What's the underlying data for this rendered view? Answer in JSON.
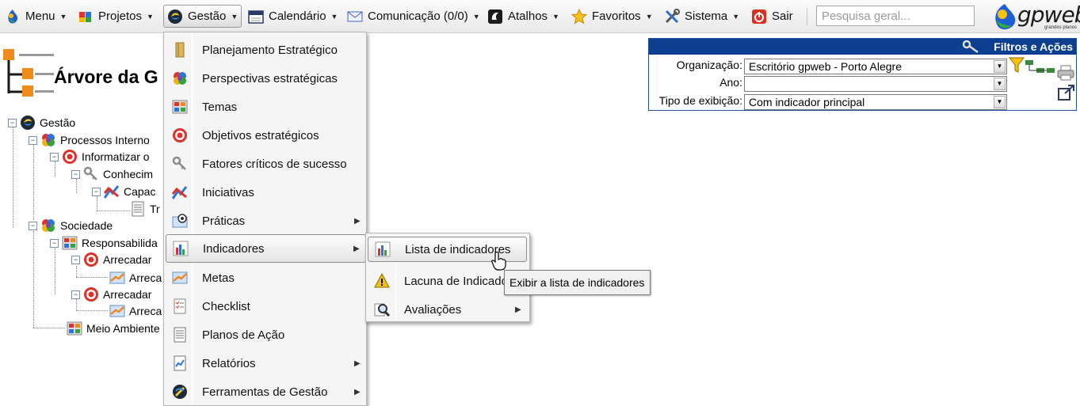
{
  "topbar": {
    "items": [
      {
        "label": "Menu",
        "icon": "gpweb-logo-icon",
        "has_caret": true
      },
      {
        "label": "Projetos",
        "icon": "puzzle-icon",
        "has_caret": true
      },
      {
        "label": "Gestão",
        "icon": "gestao-icon",
        "has_caret": true,
        "active": true
      },
      {
        "label": "Calendário",
        "icon": "calendar-icon",
        "has_caret": true
      },
      {
        "label": "Comunicação (0/0)",
        "icon": "envelope-icon",
        "has_caret": true
      },
      {
        "label": "Atalhos",
        "icon": "shortcut-icon",
        "has_caret": true
      },
      {
        "label": "Favoritos",
        "icon": "star-icon",
        "has_caret": true
      },
      {
        "label": "Sistema",
        "icon": "tools-icon",
        "has_caret": true
      },
      {
        "label": "Sair",
        "icon": "power-icon",
        "has_caret": false
      }
    ],
    "search_placeholder": "Pesquisa geral...",
    "logo_text": "gpweb",
    "logo_sub": "grandes planos"
  },
  "page": {
    "title": "Árvore da G"
  },
  "tree": [
    {
      "label": "Gestão",
      "icon": "gestao-icon"
    },
    {
      "label": "Processos Interno",
      "icon": "perspective-icon"
    },
    {
      "label": "Informatizar o",
      "icon": "target-icon"
    },
    {
      "label": "Conhecim",
      "icon": "key-icon"
    },
    {
      "label": "Capac",
      "icon": "initiative-icon"
    },
    {
      "label": "Tr",
      "icon": "document-icon"
    },
    {
      "label": "Sociedade",
      "icon": "perspective-icon"
    },
    {
      "label": "Responsabilida",
      "icon": "theme-icon"
    },
    {
      "label": "Arrecadar",
      "icon": "target-icon"
    },
    {
      "label": "Arreca",
      "icon": "goal-icon"
    },
    {
      "label": "Arrecadar",
      "icon": "target-icon"
    },
    {
      "label": "Arreca",
      "icon": "goal-icon"
    },
    {
      "label": "Meio Ambiente",
      "icon": "theme-icon"
    }
  ],
  "filters": {
    "title": "Filtros e Ações",
    "org_label": "Organização:",
    "org_value": "Escritório gpweb - Porto Alegre",
    "year_label": "Ano:",
    "year_value": "",
    "display_label": "Tipo de exibição:",
    "display_value": "Com indicador principal"
  },
  "gestao_menu": [
    {
      "label": "Planejamento Estratégico",
      "icon": "book-icon",
      "submenu": false
    },
    {
      "label": "Perspectivas estratégicas",
      "icon": "perspective-icon",
      "submenu": false
    },
    {
      "label": "Temas",
      "icon": "theme-icon",
      "submenu": false
    },
    {
      "label": "Objetivos estratégicos",
      "icon": "target-icon",
      "submenu": false
    },
    {
      "label": "Fatores críticos de sucesso",
      "icon": "key-icon",
      "submenu": false
    },
    {
      "label": "Iniciativas",
      "icon": "initiative-icon",
      "submenu": false
    },
    {
      "label": "Práticas",
      "icon": "practice-icon",
      "submenu": true
    },
    {
      "label": "Indicadores",
      "icon": "indicator-icon",
      "submenu": true,
      "highlighted": true
    },
    {
      "label": "Metas",
      "icon": "goal-icon",
      "submenu": false
    },
    {
      "label": "Checklist",
      "icon": "checklist-icon",
      "submenu": false
    },
    {
      "label": "Planos de Ação",
      "icon": "document-icon",
      "submenu": false
    },
    {
      "label": "Relatórios",
      "icon": "report-icon",
      "submenu": true
    },
    {
      "label": "Ferramentas de Gestão",
      "icon": "management-tools-icon",
      "submenu": true
    }
  ],
  "indicadores_menu": [
    {
      "label": "Lista de indicadores",
      "icon": "indicator-icon",
      "submenu": false,
      "highlighted": true
    },
    {
      "label": "Lacuna de Indicado",
      "icon": "warning-icon",
      "submenu": false
    },
    {
      "label": "Avaliações",
      "icon": "magnifier-icon",
      "submenu": true
    }
  ],
  "tooltip": "Exibir a lista de indicadores"
}
